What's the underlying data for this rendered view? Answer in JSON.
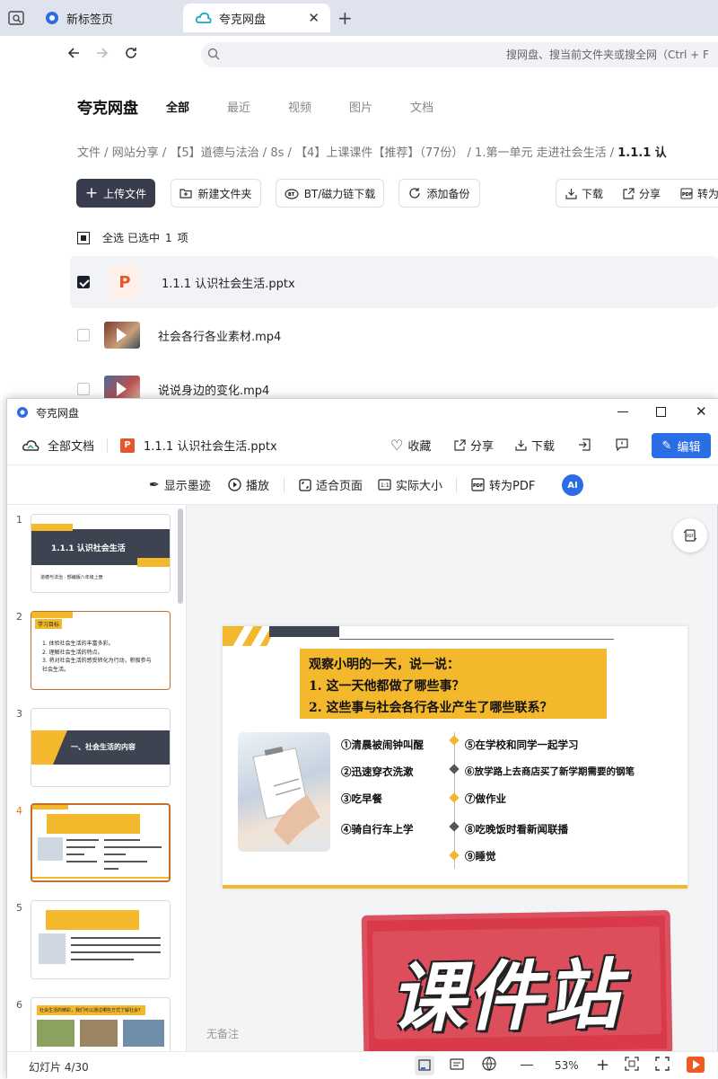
{
  "browser": {
    "tabs": [
      {
        "label": "新标签页"
      },
      {
        "label": "夸克网盘"
      }
    ],
    "address_placeholder": "搜网盘、搜当前文件夹或搜全网（Ctrl + F"
  },
  "page": {
    "brand": "夸克网盘",
    "nav": [
      "全部",
      "最近",
      "视频",
      "图片",
      "文档"
    ],
    "breadcrumb": [
      "文件",
      "/",
      "网站分享",
      "/",
      "【5】道德与法治",
      "/",
      "8s",
      "/",
      "【4】上课课件【推荐】（77份）",
      "/",
      "1.第一单元 走进社会生活",
      "/",
      "1.1.1 认"
    ],
    "buttons": {
      "upload": "上传文件",
      "new_folder": "新建文件夹",
      "bt": "BT/磁力链下载",
      "backup": "添加备份",
      "download": "下载",
      "share": "分享",
      "convert": "转为"
    },
    "selection": {
      "select_all": "全选",
      "selected": "已选中",
      "count": "1",
      "unit": "项"
    },
    "files": [
      {
        "name": "1.1.1 认识社会生活.pptx",
        "checked": true
      },
      {
        "name": "社会各行各业素材.mp4",
        "checked": false
      },
      {
        "name": "说说身边的变化.mp4",
        "checked": false
      }
    ]
  },
  "viewer": {
    "window_title": "夸克网盘",
    "all_docs": "全部文档",
    "filename": "1.1.1 认识社会生活.pptx",
    "actions": {
      "favorite": "收藏",
      "share": "分享",
      "download": "下载",
      "edit": "编辑"
    },
    "tools": {
      "ink": "显示墨迹",
      "play": "播放",
      "fit": "适合页面",
      "actual": "实际大小",
      "to_pdf": "转为PDF"
    },
    "slide_numbers": [
      "1",
      "2",
      "3",
      "4",
      "5",
      "6"
    ],
    "thumbs": {
      "s1_title": "1.1.1 认识社会生活",
      "s1_sub": "道德与法治 · 部编版八年级上册",
      "s2_tag": "学习目标",
      "s2_lines": [
        "1. 体验社会生活的丰富多彩。",
        "2. 理解社会生活的特点。",
        "3. 将对社会生活的感受转化为行动，积极参与社会生活。"
      ],
      "s3_title": "一、社会生活的内容",
      "s6_title": "社会生活的精彩，我们可以通过哪些方式了解社会？"
    },
    "slide": {
      "title_lines": [
        "观察小明的一天，说一说：",
        "1. 这一天他都做了哪些事？",
        "2. 这些事与社会各行各业产生了哪些联系？"
      ],
      "left_items": [
        "①清晨被闹钟叫醒",
        "②迅速穿衣洗漱",
        "③吃早餐",
        "④骑自行车上学"
      ],
      "right_items": [
        "⑤在学校和同学一起学习",
        "⑥放学路上去商店买了新学期需要的钢笔",
        "⑦做作业",
        "⑧吃晚饭时看新闻联播",
        "⑨睡觉"
      ]
    },
    "notes_placeholder": "无备注",
    "status": {
      "slide_counter": "幻灯片 4/30",
      "zoom": "53%"
    },
    "watermark": "课件站"
  },
  "colors": {
    "accent_blue": "#2b6de5",
    "slide_yellow": "#f4b82c",
    "dark_button": "#383c4d",
    "watermark_red": "#d83a4a"
  }
}
